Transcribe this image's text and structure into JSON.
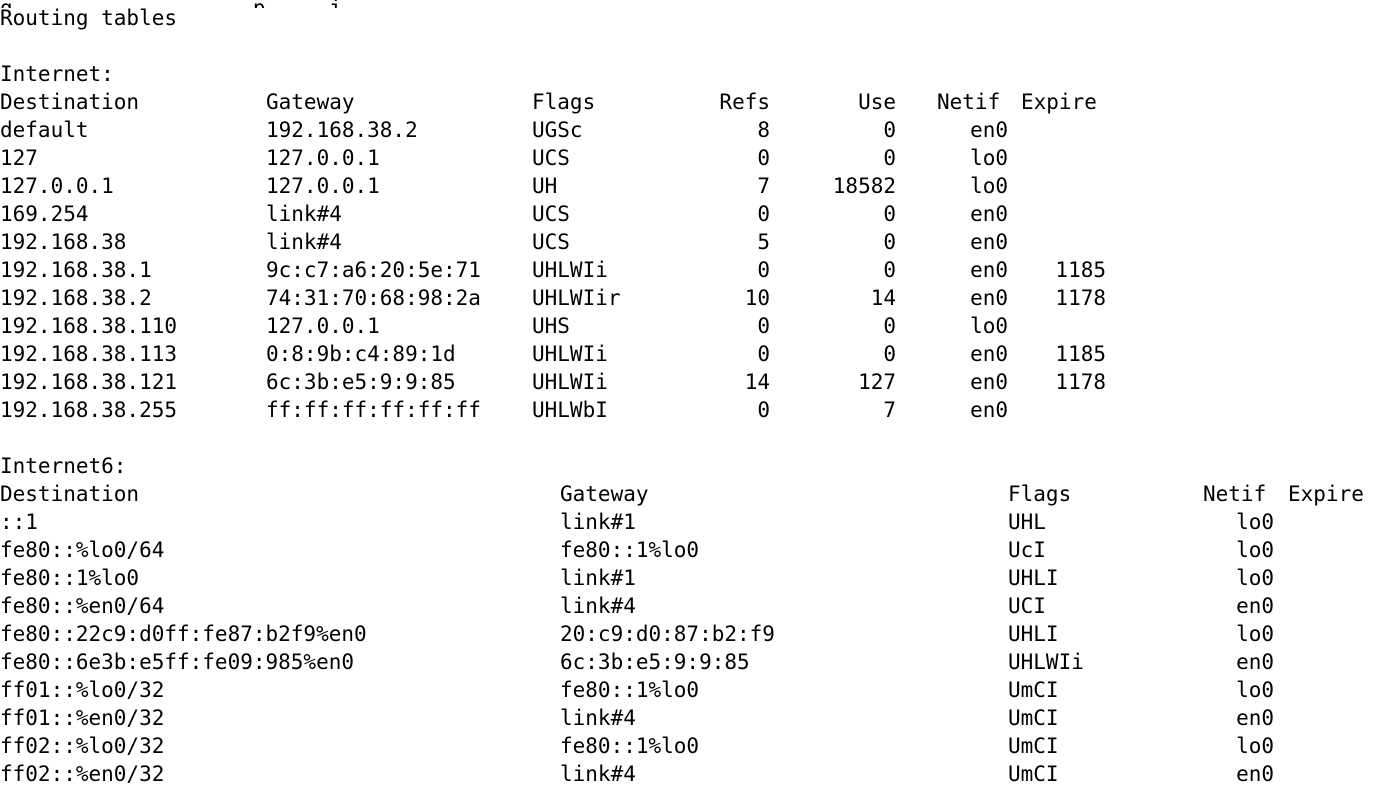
{
  "terminal": {
    "clipped_top_line": "g                   p     j   ,",
    "title": "Routing tables",
    "ipv4": {
      "section_label": "Internet:",
      "headers": {
        "destination": "Destination",
        "gateway": "Gateway",
        "flags": "Flags",
        "refs": "Refs",
        "use": "Use",
        "netif": "Netif",
        "expire": "Expire"
      },
      "rows": [
        {
          "destination": "default",
          "gateway": "192.168.38.2",
          "flags": "UGSc",
          "refs": "8",
          "use": "0",
          "netif": "en0",
          "expire": ""
        },
        {
          "destination": "127",
          "gateway": "127.0.0.1",
          "flags": "UCS",
          "refs": "0",
          "use": "0",
          "netif": "lo0",
          "expire": ""
        },
        {
          "destination": "127.0.0.1",
          "gateway": "127.0.0.1",
          "flags": "UH",
          "refs": "7",
          "use": "18582",
          "netif": "lo0",
          "expire": ""
        },
        {
          "destination": "169.254",
          "gateway": "link#4",
          "flags": "UCS",
          "refs": "0",
          "use": "0",
          "netif": "en0",
          "expire": ""
        },
        {
          "destination": "192.168.38",
          "gateway": "link#4",
          "flags": "UCS",
          "refs": "5",
          "use": "0",
          "netif": "en0",
          "expire": ""
        },
        {
          "destination": "192.168.38.1",
          "gateway": "9c:c7:a6:20:5e:71",
          "flags": "UHLWIi",
          "refs": "0",
          "use": "0",
          "netif": "en0",
          "expire": "1185"
        },
        {
          "destination": "192.168.38.2",
          "gateway": "74:31:70:68:98:2a",
          "flags": "UHLWIir",
          "refs": "10",
          "use": "14",
          "netif": "en0",
          "expire": "1178"
        },
        {
          "destination": "192.168.38.110",
          "gateway": "127.0.0.1",
          "flags": "UHS",
          "refs": "0",
          "use": "0",
          "netif": "lo0",
          "expire": ""
        },
        {
          "destination": "192.168.38.113",
          "gateway": "0:8:9b:c4:89:1d",
          "flags": "UHLWIi",
          "refs": "0",
          "use": "0",
          "netif": "en0",
          "expire": "1185"
        },
        {
          "destination": "192.168.38.121",
          "gateway": "6c:3b:e5:9:9:85",
          "flags": "UHLWIi",
          "refs": "14",
          "use": "127",
          "netif": "en0",
          "expire": "1178"
        },
        {
          "destination": "192.168.38.255",
          "gateway": "ff:ff:ff:ff:ff:ff",
          "flags": "UHLWbI",
          "refs": "0",
          "use": "7",
          "netif": "en0",
          "expire": ""
        }
      ]
    },
    "ipv6": {
      "section_label": "Internet6:",
      "headers": {
        "destination": "Destination",
        "gateway": "Gateway",
        "flags": "Flags",
        "netif": "Netif",
        "expire": "Expire"
      },
      "rows": [
        {
          "destination": "::1",
          "gateway": "link#1",
          "flags": "UHL",
          "netif": "lo0"
        },
        {
          "destination": "fe80::%lo0/64",
          "gateway": "fe80::1%lo0",
          "flags": "UcI",
          "netif": "lo0"
        },
        {
          "destination": "fe80::1%lo0",
          "gateway": "link#1",
          "flags": "UHLI",
          "netif": "lo0"
        },
        {
          "destination": "fe80::%en0/64",
          "gateway": "link#4",
          "flags": "UCI",
          "netif": "en0"
        },
        {
          "destination": "fe80::22c9:d0ff:fe87:b2f9%en0",
          "gateway": "20:c9:d0:87:b2:f9",
          "flags": "UHLI",
          "netif": "lo0"
        },
        {
          "destination": "fe80::6e3b:e5ff:fe09:985%en0",
          "gateway": "6c:3b:e5:9:9:85",
          "flags": "UHLWIi",
          "netif": "en0"
        },
        {
          "destination": "ff01::%lo0/32",
          "gateway": "fe80::1%lo0",
          "flags": "UmCI",
          "netif": "lo0"
        },
        {
          "destination": "ff01::%en0/32",
          "gateway": "link#4",
          "flags": "UmCI",
          "netif": "en0"
        },
        {
          "destination": "ff02::%lo0/32",
          "gateway": "fe80::1%lo0",
          "flags": "UmCI",
          "netif": "lo0"
        },
        {
          "destination": "ff02::%en0/32",
          "gateway": "link#4",
          "flags": "UmCI",
          "netif": "en0"
        }
      ]
    }
  }
}
